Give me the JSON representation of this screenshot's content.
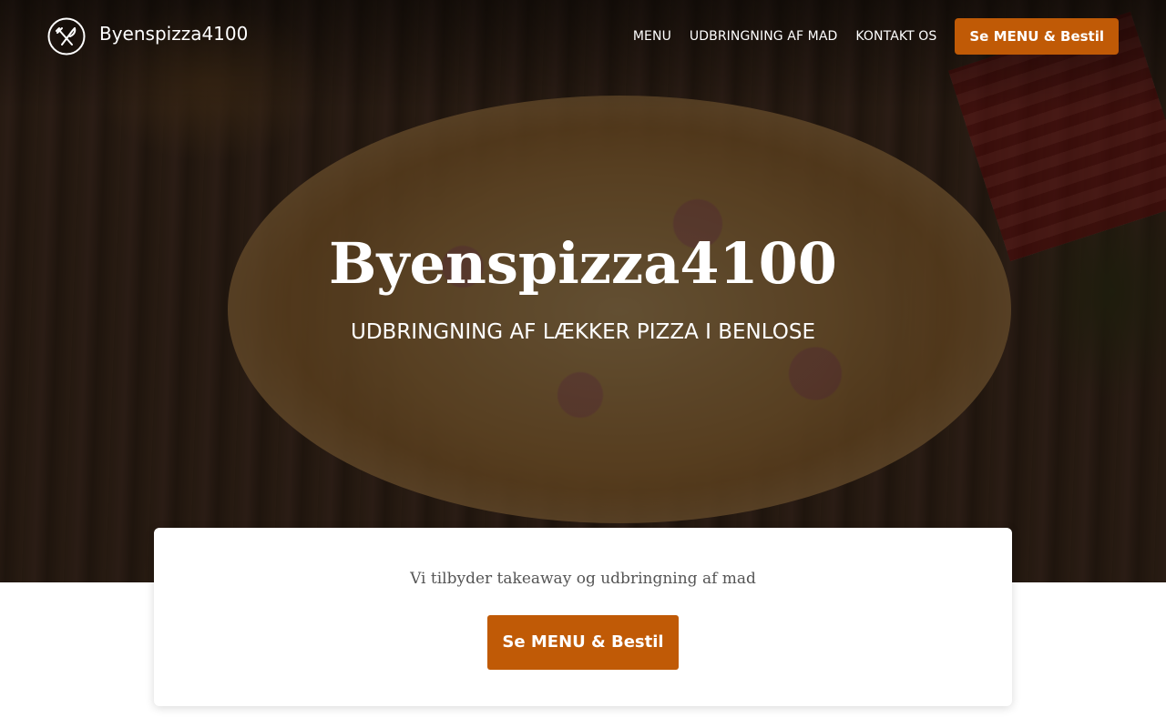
{
  "header": {
    "brand_name": "Byenspizza4100",
    "nav": [
      {
        "label": "MENU"
      },
      {
        "label": "UDBRINGNING AF MAD"
      },
      {
        "label": "KONTAKT OS"
      }
    ],
    "cta_label": "Se MENU & Bestil"
  },
  "hero": {
    "title": "Byenspizza4100",
    "subtitle": "UDBRINGNING AF LÆKKER PIZZA I BENLOSE"
  },
  "card": {
    "text": "Vi tilbyder takeaway og udbringning af mad",
    "cta_label": "Se MENU & Bestil"
  },
  "colors": {
    "accent": "#c05a06",
    "card_background": "#ffffff",
    "overlay": "rgba(0,0,0,0.5)"
  },
  "icons": {
    "logo": "fork-knife-crossed-icon"
  }
}
